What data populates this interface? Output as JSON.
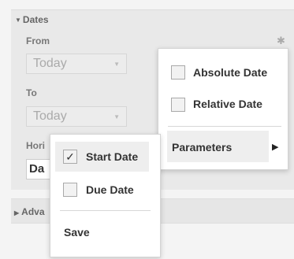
{
  "dates_panel": {
    "title": "Dates",
    "from_label": "From",
    "from_value": "Today",
    "to_label": "To",
    "to_value": "Today",
    "horizon_label_partial": "Hori",
    "horizon_value_partial": "Da"
  },
  "advanced": {
    "label_partial": "Adva"
  },
  "main_menu": {
    "items": [
      {
        "label": "Start Date",
        "checked": true,
        "check_glyph": "✓"
      },
      {
        "label": "Due Date",
        "checked": false
      }
    ],
    "save_label": "Save"
  },
  "submenu": {
    "items": [
      {
        "label": "Absolute Date",
        "checked": false
      },
      {
        "label": "Relative Date",
        "checked": false
      }
    ],
    "parameters_label": "Parameters"
  }
}
